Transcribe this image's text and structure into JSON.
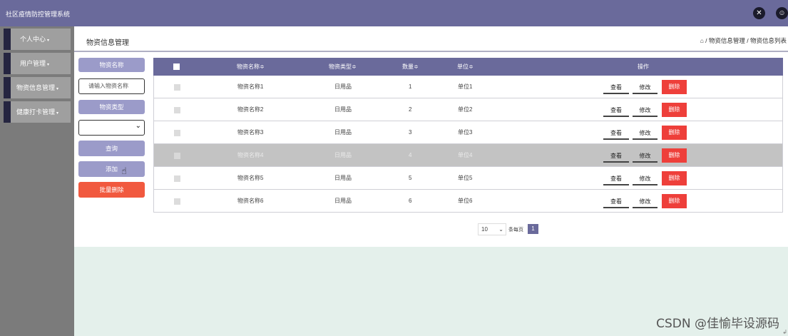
{
  "header": {
    "app_title": "社区疫情防控管理系统",
    "icons": [
      "fullscreen-icon",
      "user-icon"
    ]
  },
  "sidebar": {
    "items": [
      {
        "label": "个人中心",
        "caret": "▾"
      },
      {
        "label": "用户管理",
        "caret": "▾"
      },
      {
        "label": "物资信息管理",
        "caret": "▾"
      },
      {
        "label": "健康打卡管理",
        "caret": "▾"
      }
    ]
  },
  "main": {
    "page_title": "物资信息管理",
    "breadcrumb": "⌂ / 物资信息管理 / 物资信息列表"
  },
  "filters": {
    "name_label": "物资名称",
    "name_placeholder": "请输入物资名称",
    "type_label": "物资类型",
    "type_value": "",
    "search_button": "查询",
    "add_button": "添加",
    "batch_delete_button": "批量删除"
  },
  "table": {
    "columns": [
      "物资名称≑",
      "物资类型≑",
      "数量≑",
      "单位≑",
      "操作"
    ],
    "rows": [
      {
        "name": "物资名称1",
        "type": "日用品",
        "qty": "1",
        "unit": "单位1"
      },
      {
        "name": "物资名称2",
        "type": "日用品",
        "qty": "2",
        "unit": "单位2"
      },
      {
        "name": "物资名称3",
        "type": "日用品",
        "qty": "3",
        "unit": "单位3"
      },
      {
        "name": "物资名称4",
        "type": "日用品",
        "qty": "4",
        "unit": "单位4"
      },
      {
        "name": "物资名称5",
        "type": "日用品",
        "qty": "5",
        "unit": "单位5"
      },
      {
        "name": "物资名称6",
        "type": "日用品",
        "qty": "6",
        "unit": "单位6"
      }
    ],
    "actions": {
      "view": "查看",
      "edit": "修改",
      "delete": "删除"
    }
  },
  "pagination": {
    "page_size": "10",
    "page_size_suffix": "条每页",
    "current_page": "1"
  },
  "colors": {
    "primary": "#6a6a9b",
    "accent_light": "#9b9bc9",
    "danger": "#ee3f3a",
    "sidebar_bg": "#7b7b7b",
    "footer_bg": "#e4f0eb"
  },
  "watermark": {
    "text": "CSDN @佳愉毕设源码",
    "mark": "↲"
  }
}
